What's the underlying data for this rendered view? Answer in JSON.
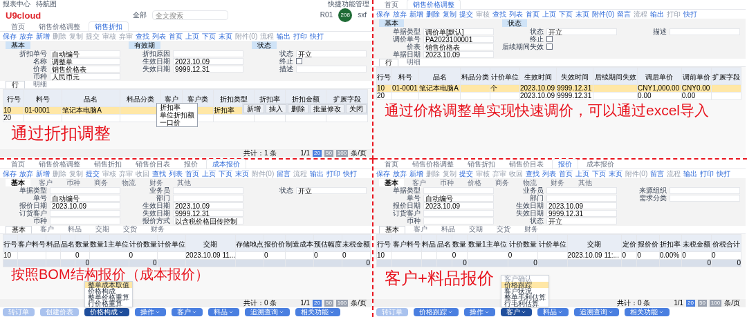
{
  "panels": [
    {
      "header": {
        "links": [
          "报表中心",
          "待航图"
        ],
        "logo": "U9cloud",
        "scope": "全部",
        "placeholder": "全文搜索",
        "org": "R01",
        "shortcut": "快捷功能管理",
        "avatar": "208",
        "user": "sxf"
      },
      "tabs": [
        {
          "label": "首页",
          "selected": false
        },
        {
          "label": "销售价格调整",
          "selected": false
        },
        {
          "label": "销售折扣",
          "selected": true
        }
      ],
      "toolbar": [
        {
          "label": "保存",
          "disabled": false
        },
        {
          "label": "放弃",
          "disabled": false
        },
        {
          "label": "新增",
          "disabled": false
        },
        {
          "label": "删除",
          "disabled": true
        },
        {
          "label": "复制",
          "disabled": true
        },
        {
          "label": "提交",
          "disabled": true
        },
        {
          "label": "审核",
          "disabled": true
        },
        {
          "label": "弃审",
          "disabled": true
        },
        {
          "label": "查找",
          "disabled": false
        },
        {
          "label": "列表",
          "disabled": false
        },
        {
          "label": "首页",
          "disabled": false
        },
        {
          "label": "上页",
          "disabled": false
        },
        {
          "label": "下页",
          "disabled": false
        },
        {
          "label": "末页",
          "disabled": false
        },
        {
          "label": "附件(0)",
          "disabled": true
        },
        {
          "label": "流程",
          "disabled": true
        },
        {
          "label": "输出",
          "disabled": false
        },
        {
          "label": "打印",
          "disabled": false
        },
        {
          "label": "快打",
          "disabled": false
        }
      ],
      "sections": [
        "基本",
        "有效期",
        "状态"
      ],
      "fields": [
        {
          "kind": "text",
          "label": "折扣单号",
          "value": "自动编号"
        },
        {
          "kind": "text",
          "label": "折扣原因"
        },
        {
          "kind": "text",
          "label": "状态",
          "value": "开立"
        },
        {
          "kind": "text",
          "label": "名称",
          "value": "调整单"
        },
        {
          "kind": "text",
          "label": "生效日期",
          "value": "2023.10.09"
        },
        {
          "kind": "check",
          "label": "终止",
          "checked": false
        },
        {
          "kind": "text",
          "label": "价表",
          "value": "销售价格表"
        },
        {
          "kind": "text",
          "label": "失效日期",
          "value": "9999.12.31"
        },
        {
          "kind": "text",
          "label": "描述"
        },
        {
          "kind": "text",
          "label": "币种",
          "value": "人民币元"
        }
      ],
      "line_tabs": [
        {
          "label": "行",
          "selected": true
        },
        {
          "label": "明细",
          "selected": false
        }
      ],
      "table": {
        "columns": [
          "行号",
          "料号",
          "品名",
          "料品分类",
          "客户",
          "客户类",
          "折扣类型",
          "折扣率",
          "折扣金额",
          "扩展字段"
        ],
        "rows": [
          {
            "selected": true,
            "cells": {
              "line_no": "10",
              "item_code": "01-0001",
              "item_name": "笔记本电脑A",
              "discount_type": "折扣率"
            }
          },
          {
            "selected": false,
            "cells": {
              "line_no": "20"
            }
          }
        ]
      },
      "dropdown": {
        "options": [
          {
            "label": "折扣率",
            "selected": false
          },
          {
            "label": "单位折扣额",
            "selected": false
          },
          {
            "label": "一口价",
            "selected": false
          }
        ]
      },
      "row_buttons": [
        "新增",
        "插入",
        "删除",
        "批量修改",
        "关闭"
      ],
      "caption": "通过折扣调整",
      "footer": {
        "count": "共计：1 条",
        "page": "1/1",
        "sizes": [
          {
            "label": "20",
            "selected": true
          },
          {
            "label": "50",
            "selected": false
          },
          {
            "label": "100",
            "selected": false
          }
        ],
        "unit": "条/页"
      }
    },
    {
      "tabs": [
        {
          "label": "首页",
          "selected": false
        },
        {
          "label": "销售价格调整",
          "selected": true
        }
      ],
      "toolbar": [
        {
          "label": "保存",
          "disabled": false
        },
        {
          "label": "放弃",
          "disabled": false
        },
        {
          "label": "新增",
          "disabled": false
        },
        {
          "label": "删除",
          "disabled": false
        },
        {
          "label": "复制",
          "disabled": false
        },
        {
          "label": "提交",
          "disabled": false
        },
        {
          "label": "审核",
          "disabled": true
        },
        {
          "label": "查找",
          "disabled": false
        },
        {
          "label": "列表",
          "disabled": false
        },
        {
          "label": "首页",
          "disabled": false
        },
        {
          "label": "上页",
          "disabled": false
        },
        {
          "label": "下页",
          "disabled": false
        },
        {
          "label": "末页",
          "disabled": false
        },
        {
          "label": "附件(0)",
          "disabled": false
        },
        {
          "label": "留言",
          "disabled": false
        },
        {
          "label": "流程",
          "disabled": true
        },
        {
          "label": "输出",
          "disabled": false
        },
        {
          "label": "打印",
          "disabled": true
        },
        {
          "label": "快打",
          "disabled": false
        }
      ],
      "sections": [
        "基本",
        "状态"
      ],
      "fields": [
        {
          "kind": "text",
          "label": "单据类型",
          "value": "调价单[默认]"
        },
        {
          "kind": "text",
          "label": "状态",
          "value": "开立"
        },
        {
          "kind": "text",
          "label": "描述"
        },
        {
          "kind": "text",
          "label": "调价单号",
          "value": "PA2023100001"
        },
        {
          "kind": "check",
          "label": "终止",
          "checked": false
        },
        {
          "kind": "blank"
        },
        {
          "kind": "text",
          "label": "价表",
          "value": "销售价格表"
        },
        {
          "kind": "check",
          "label": "后续期间失效",
          "checked": false
        },
        {
          "kind": "blank"
        },
        {
          "kind": "text",
          "label": "单据日期",
          "value": "2023.10.09"
        }
      ],
      "line_tabs": [
        {
          "label": "行",
          "selected": true
        },
        {
          "label": "明细",
          "selected": false
        }
      ],
      "table": {
        "columns": [
          "行号",
          "料号",
          "品名",
          "料品分类",
          "计价单位",
          "生效时间",
          "失效时间",
          "后续期间失效",
          "调后单价",
          "调前单价",
          "扩展字段"
        ],
        "rows": [
          {
            "selected": true,
            "cells": {
              "line_no": "10",
              "item_code": "01-0001",
              "item_name": "笔记本电脑A",
              "pricing_unit": "个",
              "effective_time": "2023.10.09",
              "expiry_time": "9999.12.31",
              "price_after": "CNY1,000.00",
              "price_before": "CNY0.00"
            }
          },
          {
            "selected": false,
            "cells": {
              "line_no": "20",
              "effective_time": "2023.10.09",
              "expiry_time": "9999.12.31",
              "price_after": "0.00",
              "price_before": "0.00"
            }
          }
        ]
      },
      "caption": "通过价格调整单实现快速调价，可以通过excel导入"
    },
    {
      "tabs": [
        {
          "label": "首页",
          "selected": false
        },
        {
          "label": "销售价格调整",
          "selected": false
        },
        {
          "label": "销售折扣",
          "selected": false
        },
        {
          "label": "销售价目表",
          "selected": false
        },
        {
          "label": "报价",
          "selected": false
        },
        {
          "label": "成本报价",
          "selected": true
        }
      ],
      "toolbar": [
        {
          "label": "保存",
          "disabled": false
        },
        {
          "label": "放弃",
          "disabled": false
        },
        {
          "label": "新增",
          "disabled": false
        },
        {
          "label": "删除",
          "disabled": true
        },
        {
          "label": "复制",
          "disabled": true
        },
        {
          "label": "提交",
          "disabled": false
        },
        {
          "label": "审核",
          "disabled": true
        },
        {
          "label": "弃审",
          "disabled": true
        },
        {
          "label": "收回",
          "disabled": true
        },
        {
          "label": "查找",
          "disabled": false
        },
        {
          "label": "列表",
          "disabled": false
        },
        {
          "label": "首页",
          "disabled": false
        },
        {
          "label": "上页",
          "disabled": false
        },
        {
          "label": "下页",
          "disabled": false
        },
        {
          "label": "末页",
          "disabled": false
        },
        {
          "label": "附件(0)",
          "disabled": true
        },
        {
          "label": "留言",
          "disabled": false
        },
        {
          "label": "流程",
          "disabled": true
        },
        {
          "label": "输出",
          "disabled": false
        },
        {
          "label": "打印",
          "disabled": false
        },
        {
          "label": "快打",
          "disabled": false
        }
      ],
      "form_tabs": [
        {
          "label": "基本",
          "selected": true
        },
        {
          "label": "客户",
          "selected": false
        },
        {
          "label": "币种",
          "selected": false
        },
        {
          "label": "商务",
          "selected": false
        },
        {
          "label": "物流",
          "selected": false
        },
        {
          "label": "财务",
          "selected": false
        },
        {
          "label": "其他",
          "selected": false
        }
      ],
      "fields": [
        {
          "kind": "text",
          "label": "单据类型"
        },
        {
          "kind": "text",
          "label": "业务员"
        },
        {
          "kind": "text",
          "label": "状态",
          "value": "开立"
        },
        {
          "kind": "text",
          "label": "单号",
          "value": "自动编号"
        },
        {
          "kind": "text",
          "label": "部门"
        },
        {
          "kind": "blank"
        },
        {
          "kind": "text",
          "label": "报价日期",
          "value": "2023.10.09"
        },
        {
          "kind": "text",
          "label": "生效日期",
          "value": "2023.10.09"
        },
        {
          "kind": "blank"
        },
        {
          "kind": "text",
          "label": "订货客户"
        },
        {
          "kind": "text",
          "label": "失效日期",
          "value": "9999.12.31"
        },
        {
          "kind": "blank"
        },
        {
          "kind": "text",
          "label": "币种"
        },
        {
          "kind": "text",
          "label": "报价方式",
          "value": "以含税价格回传控制"
        }
      ],
      "line_tabs": [
        {
          "label": "基本",
          "selected": true
        },
        {
          "label": "客户",
          "selected": false
        },
        {
          "label": "料品",
          "selected": false
        },
        {
          "label": "交期",
          "selected": false
        },
        {
          "label": "交货",
          "selected": false
        },
        {
          "label": "财务",
          "selected": false
        }
      ],
      "table": {
        "columns": [
          "行号",
          "客户料号",
          "料品",
          "品名",
          "数量",
          "数量1主单位",
          "计价数量",
          "计价单位",
          "交期",
          "存储地点",
          "报价价",
          "制造成本",
          "预估幅度",
          "未税金额"
        ],
        "rows": [
          {
            "selected": false,
            "cells": {
              "line_no": "10",
              "quantity": "0",
              "pricing_quantity": "0",
              "delivery_date": "2023.10.09 11...",
              "quote_price": "0",
              "cost_range": "0",
              "untaxed_amount": "0"
            }
          }
        ],
        "total": {
          "quantity": "0",
          "pricing_quantity": "0",
          "untaxed_amount": "0"
        }
      },
      "caption": "按照BOM结构报价（成本报价）",
      "menu": [
        {
          "label": "整单成本取值",
          "selected": true,
          "disabled": false
        },
        {
          "label": "价格构成",
          "selected": false,
          "disabled": false
        },
        {
          "label": "整单价格重算",
          "selected": false,
          "disabled": false
        },
        {
          "label": "行价格重算",
          "selected": false,
          "disabled": false
        }
      ],
      "buttons": [
        {
          "label": "转订单",
          "kind": "plain",
          "open": false
        },
        {
          "label": "创建价表",
          "kind": "plain",
          "open": false
        },
        {
          "label": "价格构成",
          "kind": "menu",
          "open": true
        },
        {
          "label": "操作",
          "kind": "menu",
          "open": false
        },
        {
          "label": "客户",
          "kind": "menu",
          "open": false
        },
        {
          "label": "料品",
          "kind": "menu",
          "open": false
        },
        {
          "label": "追溯查询",
          "kind": "menu",
          "open": false
        },
        {
          "label": "相关功能",
          "kind": "menu",
          "open": false
        }
      ],
      "footer": {
        "count": "共计：0 条",
        "page": "1/1",
        "sizes": [
          {
            "label": "20",
            "selected": true
          },
          {
            "label": "50",
            "selected": false
          },
          {
            "label": "100",
            "selected": false
          }
        ],
        "unit": "条/页"
      }
    },
    {
      "tabs": [
        {
          "label": "首页",
          "selected": false
        },
        {
          "label": "销售价格调整",
          "selected": false
        },
        {
          "label": "销售折扣",
          "selected": false
        },
        {
          "label": "销售价目表",
          "selected": false
        },
        {
          "label": "报价",
          "selected": true
        },
        {
          "label": "成本报价",
          "selected": false
        }
      ],
      "toolbar": [
        {
          "label": "保存",
          "disabled": false
        },
        {
          "label": "放弃",
          "disabled": false
        },
        {
          "label": "新增",
          "disabled": false
        },
        {
          "label": "删除",
          "disabled": true
        },
        {
          "label": "复制",
          "disabled": true
        },
        {
          "label": "提交",
          "disabled": false
        },
        {
          "label": "审核",
          "disabled": true
        },
        {
          "label": "弃审",
          "disabled": true
        },
        {
          "label": "收回",
          "disabled": true
        },
        {
          "label": "查找",
          "disabled": false
        },
        {
          "label": "列表",
          "disabled": false
        },
        {
          "label": "首页",
          "disabled": false
        },
        {
          "label": "上页",
          "disabled": false
        },
        {
          "label": "下页",
          "disabled": false
        },
        {
          "label": "末页",
          "disabled": false
        },
        {
          "label": "附件(0)",
          "disabled": true
        },
        {
          "label": "留言",
          "disabled": false
        },
        {
          "label": "流程",
          "disabled": true
        },
        {
          "label": "输出",
          "disabled": false
        },
        {
          "label": "打印",
          "disabled": false
        },
        {
          "label": "快打",
          "disabled": false
        }
      ],
      "form_tabs": [
        {
          "label": "基本",
          "selected": true
        },
        {
          "label": "客户",
          "selected": false
        },
        {
          "label": "币种",
          "selected": false
        },
        {
          "label": "价格",
          "selected": false
        },
        {
          "label": "商务",
          "selected": false
        },
        {
          "label": "物流",
          "selected": false
        },
        {
          "label": "财务",
          "selected": false
        },
        {
          "label": "其他",
          "selected": false
        }
      ],
      "fields": [
        {
          "kind": "text",
          "label": "单据类型"
        },
        {
          "kind": "text",
          "label": "业务员"
        },
        {
          "kind": "text",
          "label": "来源组织"
        },
        {
          "kind": "text",
          "label": "单号",
          "value": "自动编号"
        },
        {
          "kind": "text",
          "label": "部门"
        },
        {
          "kind": "text",
          "label": "需求分类"
        },
        {
          "kind": "text",
          "label": "报价日期",
          "value": "2023.10.09"
        },
        {
          "kind": "text",
          "label": "生效日期",
          "value": "2023.10.09"
        },
        {
          "kind": "blank"
        },
        {
          "kind": "text",
          "label": "订货客户"
        },
        {
          "kind": "text",
          "label": "失效日期",
          "value": "9999.12.31"
        },
        {
          "kind": "blank"
        },
        {
          "kind": "text",
          "label": "币种"
        },
        {
          "kind": "text",
          "label": "状态",
          "value": "开立"
        }
      ],
      "line_tabs": [
        {
          "label": "基本",
          "selected": true
        },
        {
          "label": "客户",
          "selected": false
        },
        {
          "label": "料品",
          "selected": false
        },
        {
          "label": "交期",
          "selected": false
        },
        {
          "label": "交货",
          "selected": false
        },
        {
          "label": "财务",
          "selected": false
        }
      ],
      "table": {
        "columns": [
          "行号",
          "客户料号",
          "料品",
          "品名",
          "数量",
          "数量1主单位",
          "计价数量",
          "计价单位",
          "交期",
          "定价",
          "报价价",
          "折扣率",
          "未税金额",
          "价税合计"
        ],
        "rows": [
          {
            "selected": false,
            "cells": {
              "line_no": "10",
              "quantity": "0",
              "pricing_quantity": "0",
              "delivery_date": "2023.10.09 11:...",
              "list_price": "0",
              "quote_price": "0",
              "discount_rate": "0.00%",
              "untaxed_amount": "0",
              "total_with_tax": "0"
            }
          }
        ],
        "total": {
          "quantity": "0",
          "pricing_quantity": "0",
          "untaxed_amount": "0",
          "total_with_tax": "0"
        }
      },
      "caption": "客户+料品报价",
      "menu": [
        {
          "label": "客户确认",
          "selected": false,
          "disabled": true
        },
        {
          "label": "价格跟踪",
          "selected": true,
          "disabled": false
        },
        {
          "label": "客户状况",
          "selected": false,
          "disabled": false
        },
        {
          "label": "整单毛利估算",
          "selected": false,
          "disabled": false
        },
        {
          "label": "行毛利估算",
          "selected": false,
          "disabled": false
        }
      ],
      "buttons": [
        {
          "label": "转订单",
          "kind": "plain",
          "open": false
        },
        {
          "label": "价格跟踪",
          "kind": "menu",
          "open": false
        },
        {
          "label": "操作",
          "kind": "menu",
          "open": false
        },
        {
          "label": "客户",
          "kind": "menu",
          "open": true
        },
        {
          "label": "料品",
          "kind": "menu",
          "open": false
        },
        {
          "label": "追溯查询",
          "kind": "menu",
          "open": false
        },
        {
          "label": "相关功能",
          "kind": "menu",
          "open": false
        }
      ],
      "footer": {
        "count": "共计：0 条",
        "page": "1/1",
        "sizes": [
          {
            "label": "20",
            "selected": true
          },
          {
            "label": "50",
            "selected": false
          },
          {
            "label": "100",
            "selected": false
          }
        ],
        "unit": "条/页"
      }
    }
  ]
}
